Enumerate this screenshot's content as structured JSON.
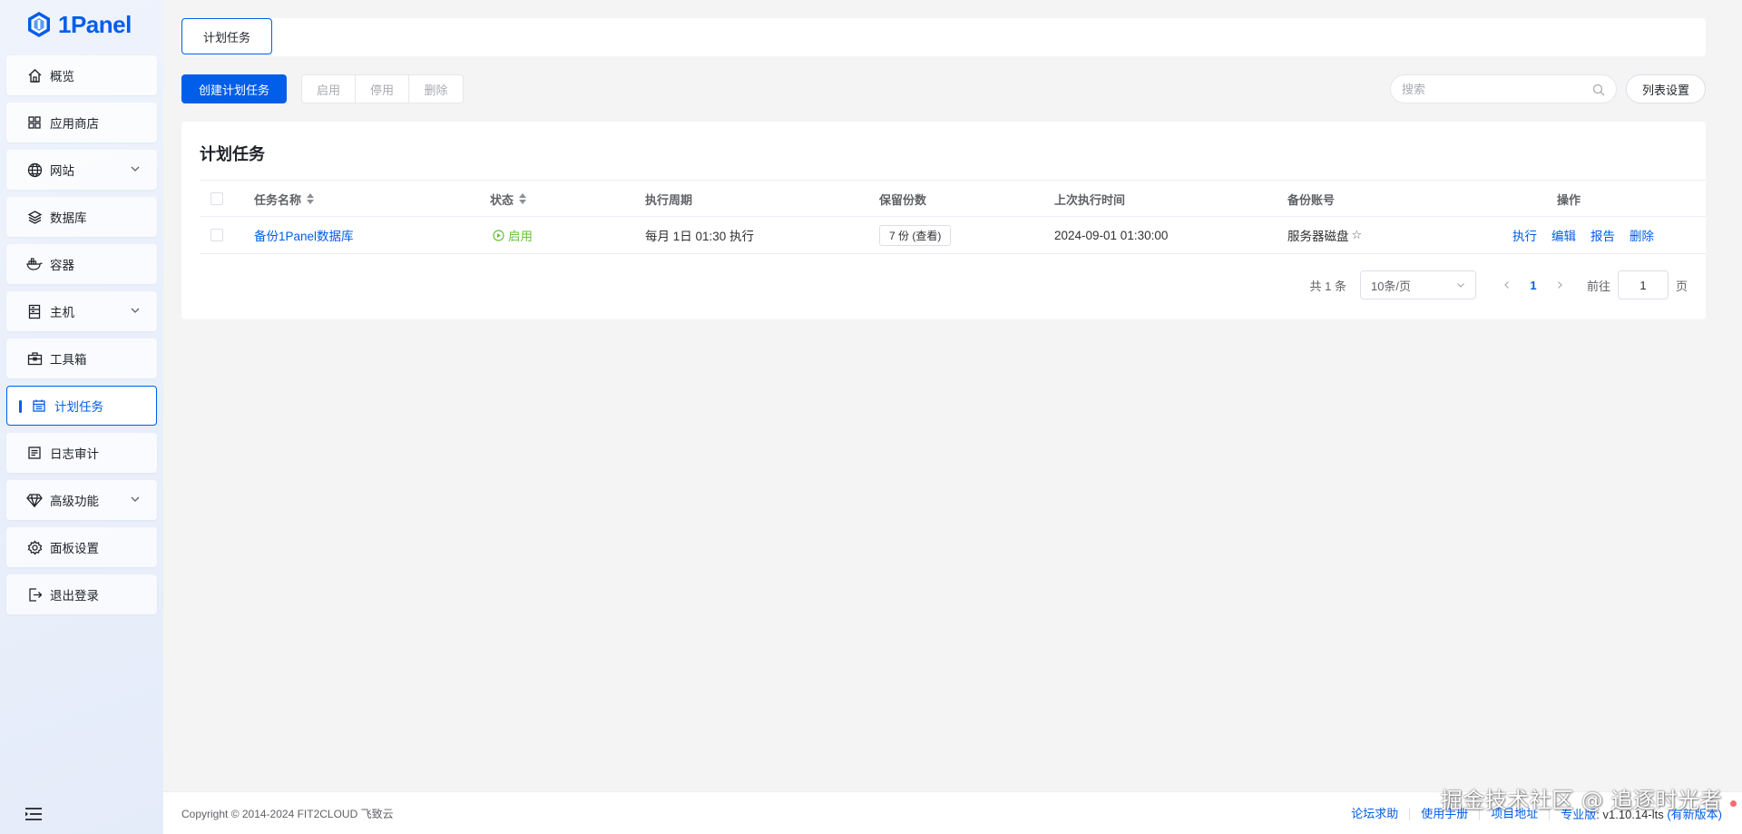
{
  "app": {
    "logo_text": "1Panel"
  },
  "sidebar": {
    "items": [
      {
        "label": "概览",
        "icon": "home-icon"
      },
      {
        "label": "应用商店",
        "icon": "grid-icon"
      },
      {
        "label": "网站",
        "icon": "globe-icon",
        "expandable": true
      },
      {
        "label": "数据库",
        "icon": "layers-icon"
      },
      {
        "label": "容器",
        "icon": "docker-icon"
      },
      {
        "label": "主机",
        "icon": "server-icon",
        "expandable": true
      },
      {
        "label": "工具箱",
        "icon": "toolbox-icon"
      },
      {
        "label": "计划任务",
        "icon": "calendar-icon",
        "active": true
      },
      {
        "label": "日志审计",
        "icon": "log-icon"
      },
      {
        "label": "高级功能",
        "icon": "diamond-icon",
        "expandable": true
      },
      {
        "label": "面板设置",
        "icon": "gear-icon"
      },
      {
        "label": "退出登录",
        "icon": "logout-icon"
      }
    ]
  },
  "tabs": {
    "active": "计划任务"
  },
  "toolbar": {
    "create_label": "创建计划任务",
    "enable_label": "启用",
    "disable_label": "停用",
    "delete_label": "删除",
    "search_placeholder": "搜索",
    "list_settings_label": "列表设置"
  },
  "card": {
    "title": "计划任务",
    "columns": {
      "name": "任务名称",
      "status": "状态",
      "cycle": "执行周期",
      "retain": "保留份数",
      "last_run": "上次执行时间",
      "account": "备份账号",
      "ops": "操作"
    },
    "rows": [
      {
        "name": "备份1Panel数据库",
        "status": "启用",
        "cycle": "每月 1日 01:30 执行",
        "retain": "7 份 (查看)",
        "last_run": "2024-09-01 01:30:00",
        "account": "服务器磁盘",
        "ops": {
          "run": "执行",
          "edit": "编辑",
          "report": "报告",
          "delete": "删除"
        }
      }
    ]
  },
  "pagination": {
    "total": "共 1 条",
    "page_size": "10条/页",
    "current": "1",
    "goto_label": "前往",
    "goto_value": "1",
    "page_suffix": "页"
  },
  "footer": {
    "copyright": "Copyright © 2014-2024 FIT2CLOUD 飞致云",
    "links": [
      "论坛求助",
      "使用手册",
      "项目地址"
    ],
    "edition_label": "专业版",
    "version": "v1.10.14-lts",
    "new_version": "(有新版本)"
  },
  "watermark": "掘金技术社区 @ 追逐时光者",
  "colors": {
    "primary": "#005eeb",
    "success": "#67c23a",
    "sidebar_bg": "#e9effb"
  }
}
